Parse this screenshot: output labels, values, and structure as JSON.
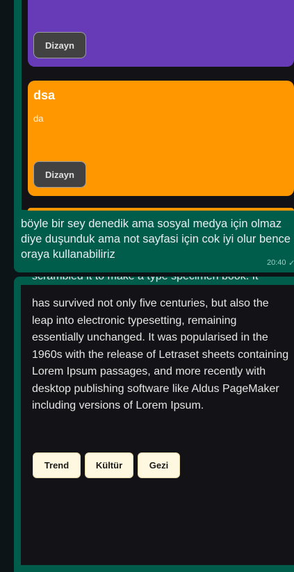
{
  "card_purple": {
    "button_label": "Dizayn"
  },
  "card_orange": {
    "title": "dsa",
    "subtitle": "da",
    "button_label": "Dizayn"
  },
  "message": {
    "text": "böyle bir sey denedik ama sosyal medya için olmaz diye duşunduk ama not sayfasi için cok iyi olur bence oraya kullanabiliriz",
    "time": "20:40",
    "status_icon": "check-icon"
  },
  "post": {
    "cut_line": "scrambled it to make a type specimen book. It",
    "body": "has survived not only five centuries, but also the leap into electronic typesetting, remaining essentially unchanged. It was popularised in the 1960s with the release of Letraset sheets containing Lorem Ipsum passages, and more recently with desktop publishing software like Aldus PageMaker including versions of Lorem Ipsum.",
    "tags": [
      "Trend",
      "Kültür",
      "Gezi"
    ]
  },
  "colors": {
    "bubble_outgoing": "#005c4b",
    "card_purple": "#673ab7",
    "card_orange": "#ff9800",
    "media_dark": "#131216",
    "tag_bg": "#fff8e1"
  }
}
